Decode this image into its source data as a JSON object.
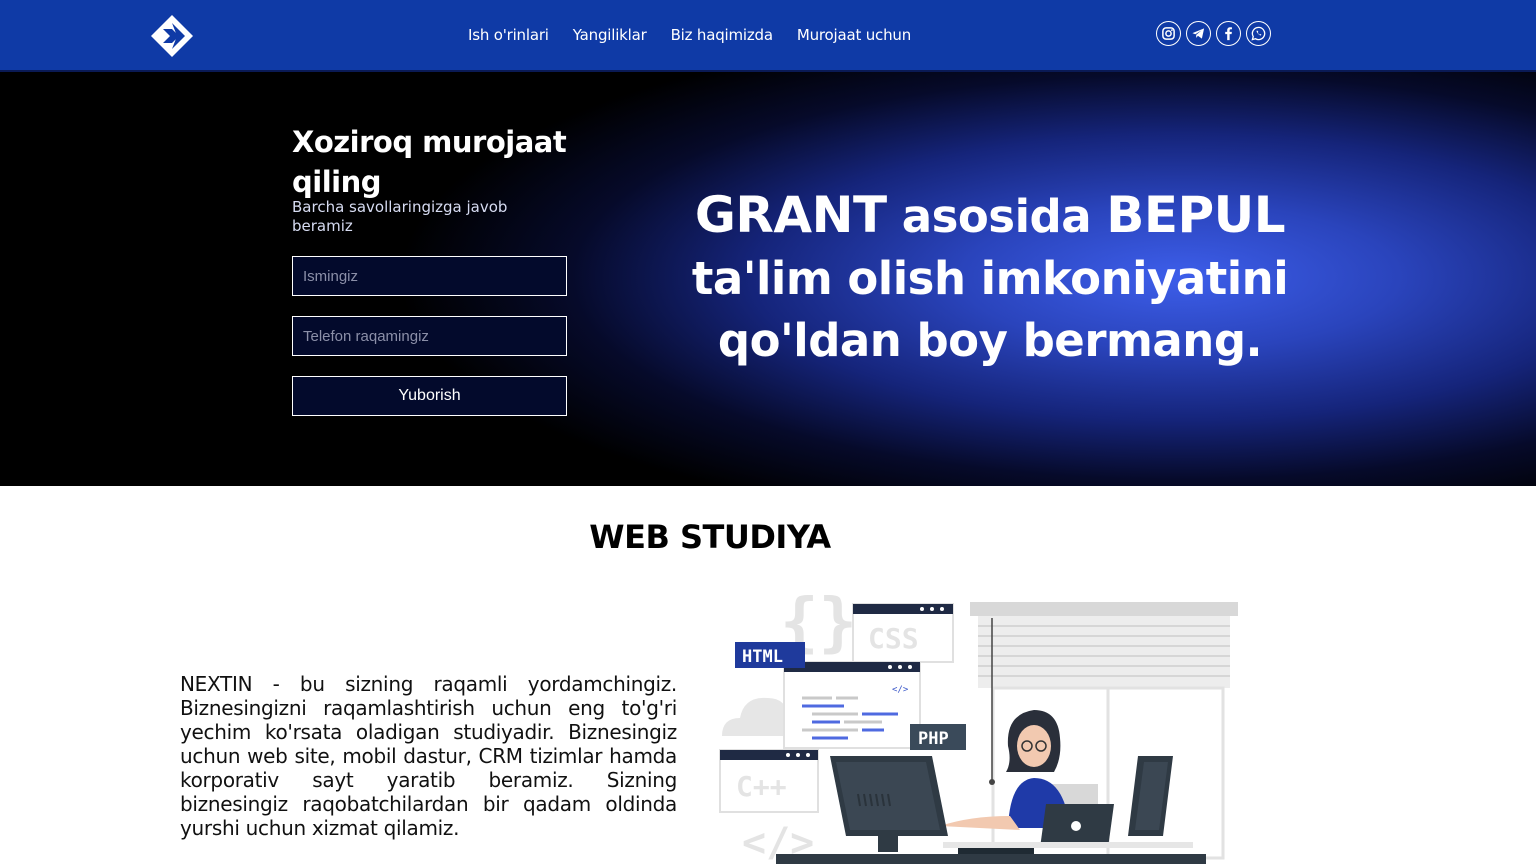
{
  "nav": {
    "items": [
      "Ish o'rinlari",
      "Yangiliklar",
      "Biz haqimizda",
      "Murojaat uchun"
    ]
  },
  "socials": [
    "instagram-icon",
    "telegram-icon",
    "facebook-icon",
    "whatsapp-icon"
  ],
  "form": {
    "title": "Xoziroq murojaat qiling",
    "subtitle": "Barcha savollaringizga javob beramiz",
    "name_placeholder": "Ismingiz",
    "phone_placeholder": "Telefon raqamingiz",
    "submit_label": "Yuborish"
  },
  "hero": {
    "word1": "GRANT",
    "word2": " asosida ",
    "word3": "BEPUL",
    "line2": "ta'lim olish imkoniyatini",
    "line3": "qo'ldan boy bermang."
  },
  "section": {
    "title": "WEB STUDIYA",
    "text": "NEXTIN - bu sizning raqamli yordamchingiz. Biznesingizni raqamlashtirish uchun eng to'g'ri yechim ko'rsata oladigan studiyadir. Biznesingiz uchun web site, mobil dastur, CRM tizimlar hamda korporativ sayt yaratib beramiz. Sizning biznesingiz raqobatchilardan bir qadam oldinda yurshi uchun xizmat qilamiz."
  },
  "illustration": {
    "labels": [
      "HTML",
      "CSS",
      "PHP",
      "C++",
      "</>"
    ]
  },
  "colors": {
    "header": "#0f3aa6",
    "accent": "#1b3c9c",
    "field_bg": "#030a2c"
  }
}
